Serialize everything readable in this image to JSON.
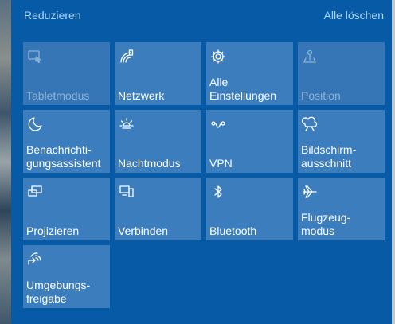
{
  "header": {
    "collapse_label": "Reduzieren",
    "clear_all_label": "Alle löschen"
  },
  "tiles": [
    {
      "label": "Tabletmodus",
      "icon": "tablet-mode-icon",
      "state": "off"
    },
    {
      "label": "Netzwerk",
      "icon": "network-icon",
      "state": "on"
    },
    {
      "label": "Alle\nEinstellungen",
      "icon": "gear-icon",
      "state": "on"
    },
    {
      "label": "Position",
      "icon": "location-icon",
      "state": "off"
    },
    {
      "label": "Benachrichti-\ngungsassistent",
      "icon": "moon-icon",
      "state": "on"
    },
    {
      "label": "Nachtmodus",
      "icon": "brightness-icon",
      "state": "on"
    },
    {
      "label": "VPN",
      "icon": "vpn-icon",
      "state": "on"
    },
    {
      "label": "Bildschirm-\nausschnitt",
      "icon": "screen-snip-icon",
      "state": "on"
    },
    {
      "label": "Projizieren",
      "icon": "project-icon",
      "state": "on"
    },
    {
      "label": "Verbinden",
      "icon": "connect-icon",
      "state": "on"
    },
    {
      "label": "Bluetooth",
      "icon": "bluetooth-icon",
      "state": "on"
    },
    {
      "label": "Flugzeug-\nmodus",
      "icon": "airplane-icon",
      "state": "on"
    },
    {
      "label": "Umgebungs-\nfreigabe",
      "icon": "nearby-sharing-icon",
      "state": "on"
    }
  ],
  "colors": {
    "panel": "#075aa6",
    "tile": "#3b7dbd",
    "link": "#a9d7ff"
  }
}
